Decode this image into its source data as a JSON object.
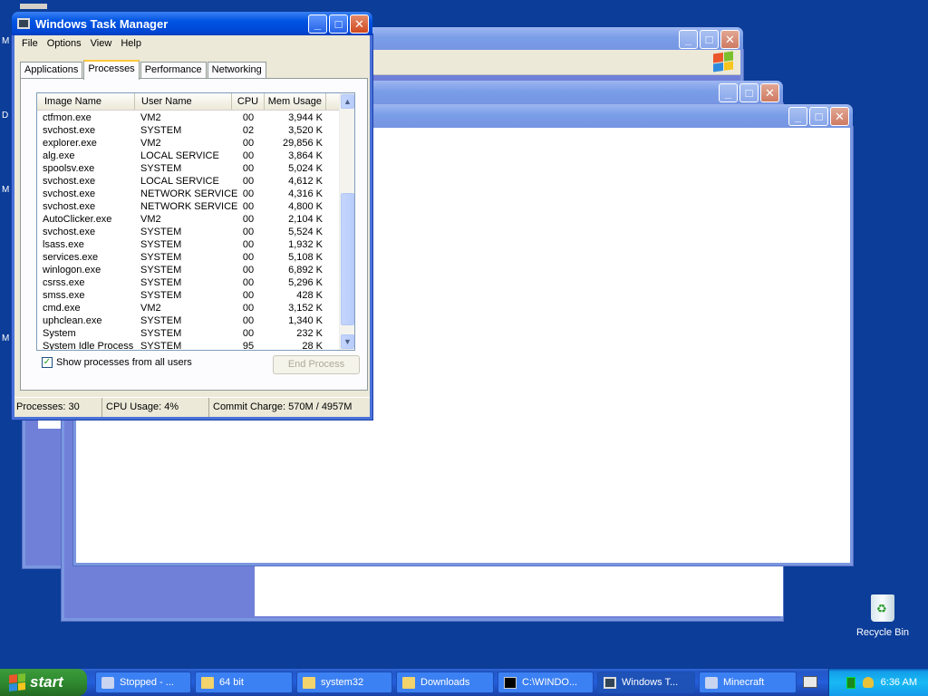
{
  "desktop": {
    "left_edge_letters": [
      "M",
      "D",
      "M",
      "M"
    ],
    "recycle_bin_label": "Recycle Bin"
  },
  "task_manager": {
    "title": "Windows Task Manager",
    "menu": [
      "File",
      "Options",
      "View",
      "Help"
    ],
    "tabs": [
      "Applications",
      "Processes",
      "Performance",
      "Networking"
    ],
    "active_tab": "Processes",
    "columns": [
      "Image Name",
      "User Name",
      "CPU",
      "Mem Usage"
    ],
    "processes": [
      [
        "ctfmon.exe",
        "VM2",
        "00",
        "3,944 K"
      ],
      [
        "svchost.exe",
        "SYSTEM",
        "02",
        "3,520 K"
      ],
      [
        "explorer.exe",
        "VM2",
        "00",
        "29,856 K"
      ],
      [
        "alg.exe",
        "LOCAL SERVICE",
        "00",
        "3,864 K"
      ],
      [
        "spoolsv.exe",
        "SYSTEM",
        "00",
        "5,024 K"
      ],
      [
        "svchost.exe",
        "LOCAL SERVICE",
        "00",
        "4,612 K"
      ],
      [
        "svchost.exe",
        "NETWORK SERVICE",
        "00",
        "4,316 K"
      ],
      [
        "svchost.exe",
        "NETWORK SERVICE",
        "00",
        "4,800 K"
      ],
      [
        "AutoClicker.exe",
        "VM2",
        "00",
        "2,104 K"
      ],
      [
        "svchost.exe",
        "SYSTEM",
        "00",
        "5,524 K"
      ],
      [
        "lsass.exe",
        "SYSTEM",
        "00",
        "1,932 K"
      ],
      [
        "services.exe",
        "SYSTEM",
        "00",
        "5,108 K"
      ],
      [
        "winlogon.exe",
        "SYSTEM",
        "00",
        "6,892 K"
      ],
      [
        "csrss.exe",
        "SYSTEM",
        "00",
        "5,296 K"
      ],
      [
        "smss.exe",
        "SYSTEM",
        "00",
        "428 K"
      ],
      [
        "cmd.exe",
        "VM2",
        "00",
        "3,152 K"
      ],
      [
        "uphclean.exe",
        "SYSTEM",
        "00",
        "1,340 K"
      ],
      [
        "System",
        "SYSTEM",
        "00",
        "232 K"
      ],
      [
        "System Idle Process",
        "SYSTEM",
        "95",
        "28 K"
      ]
    ],
    "show_all_users_label": "Show processes from all users",
    "show_all_users_checked": true,
    "end_process_label": "End Process",
    "status": {
      "processes": "Processes: 30",
      "cpu": "CPU Usage: 4%",
      "commit": "Commit Charge: 570M / 4957M"
    }
  },
  "taskbar": {
    "start_label": "start",
    "buttons": [
      {
        "label": "Stopped - ...",
        "icon": "java-icon"
      },
      {
        "label": "64 bit",
        "icon": "folder-icon"
      },
      {
        "label": "system32",
        "icon": "folder-icon"
      },
      {
        "label": "Downloads",
        "icon": "folder-icon"
      },
      {
        "label": "C:\\WINDO...",
        "icon": "cmd-icon"
      },
      {
        "label": "Windows T...",
        "icon": "taskmgr-icon"
      },
      {
        "label": "Minecraft",
        "icon": "java-icon"
      }
    ],
    "active_button": "Windows T...",
    "clock": "6:36 AM"
  }
}
